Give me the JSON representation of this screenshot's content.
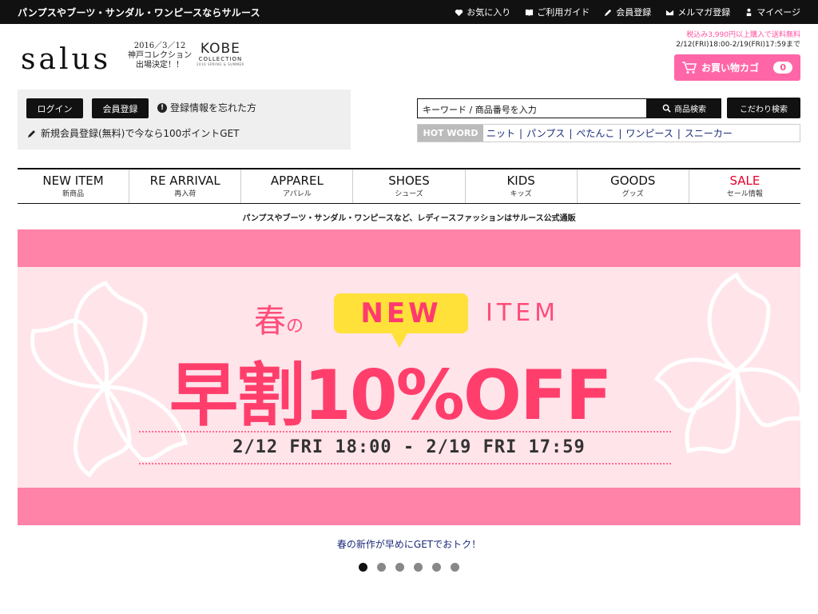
{
  "topbar": {
    "tagline": "パンプスやブーツ・サンダル・ワンピースならサルース",
    "links": [
      {
        "label": "お気に入り",
        "icon": "heart-icon"
      },
      {
        "label": "ご利用ガイド",
        "icon": "book-icon"
      },
      {
        "label": "会員登録",
        "icon": "pencil-icon"
      },
      {
        "label": "メルマガ登録",
        "icon": "mail-icon"
      },
      {
        "label": "マイページ",
        "icon": "person-icon"
      }
    ]
  },
  "header": {
    "logo": "salus",
    "kobe_date_line1": "2016／3／12",
    "kobe_date_line2": "神戸コレクション",
    "kobe_date_line3": "出場決定！！",
    "kobe_title": "KOBE",
    "kobe_sub": "COLLECTION",
    "kobe_small": "2016 SPRING & SUMMER",
    "ship_line1": "税込み3,990円以上購入で送料無料",
    "ship_line2": "2/12(FRI)18:00-2/19(FRI)17:59まで",
    "cart_label": "お買い物カゴ",
    "cart_count": "0"
  },
  "login": {
    "login_label": "ログイン",
    "member_label": "会員登録",
    "forgot_label": "登録情報を忘れた方",
    "register_label": "新規会員登録(無料)で今なら100ポイントGET"
  },
  "search": {
    "placeholder": "キーワード / 商品番号を入力",
    "button_label": "商品検索",
    "advanced_label": "こだわり検索",
    "hotword_label": "HOT WORD",
    "hotwords": [
      "ニット",
      "パンプス",
      "ぺたんこ",
      "ワンピース",
      "スニーカー"
    ]
  },
  "categories": [
    {
      "en": "NEW ITEM",
      "jp": "新商品"
    },
    {
      "en": "RE ARRIVAL",
      "jp": "再入荷"
    },
    {
      "en": "APPAREL",
      "jp": "アパレル"
    },
    {
      "en": "SHOES",
      "jp": "シューズ"
    },
    {
      "en": "KIDS",
      "jp": "キッズ"
    },
    {
      "en": "GOODS",
      "jp": "グッズ"
    },
    {
      "en": "SALE",
      "jp": "セール情報"
    }
  ],
  "subline": "パンプスやブーツ・サンダル・ワンピースなど、レディースファッションはサルース公式通販",
  "banner": {
    "spring": "春",
    "no": "の",
    "new": "NEW",
    "item": "ITEM",
    "offer": "早割10%OFF",
    "dates": "2/12 FRI 18:00 - 2/19 FRI 17:59"
  },
  "caption": "春の新作が早めにGETでおトク！",
  "pager": {
    "count": 6,
    "active": 0
  },
  "colors": {
    "accent_pink": "#ff66a8",
    "banner_pink": "#ff82a8",
    "sale_red": "#e8002d"
  }
}
